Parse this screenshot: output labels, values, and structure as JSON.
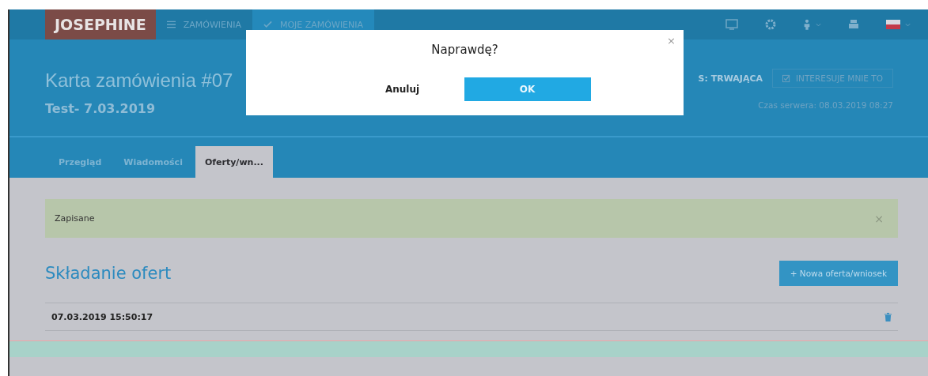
{
  "navbar": {
    "logo": "JOSEPHINE",
    "items": [
      {
        "label": "ZAMÓWIENIA",
        "selected": false
      },
      {
        "label": "MOJE ZAMÓWIENIA",
        "selected": true
      }
    ]
  },
  "header": {
    "title": "Karta zamówienia #07",
    "subtitle": "Test- 7.03.2019",
    "status": "S: TRWAJĄCA",
    "interest_button": "INTERESUJE MNIE TO",
    "server_time": "Czas serwera: 08.03.2019 08:27"
  },
  "tabs": [
    {
      "label": "Przegląd",
      "selected": false
    },
    {
      "label": "Wiadomości",
      "selected": false
    },
    {
      "label": "Oferty/wn...",
      "selected": true
    }
  ],
  "alert": {
    "text": "Zapisane",
    "close": "×"
  },
  "section": {
    "title": "Składanie ofert",
    "button": "+ Nowa oferta/wniosek"
  },
  "rows": [
    {
      "date": "07.03.2019 15:50:17"
    }
  ],
  "dialog": {
    "title": "Naprawdę?",
    "close": "×",
    "cancel": "Anuluj",
    "ok": "OK"
  }
}
